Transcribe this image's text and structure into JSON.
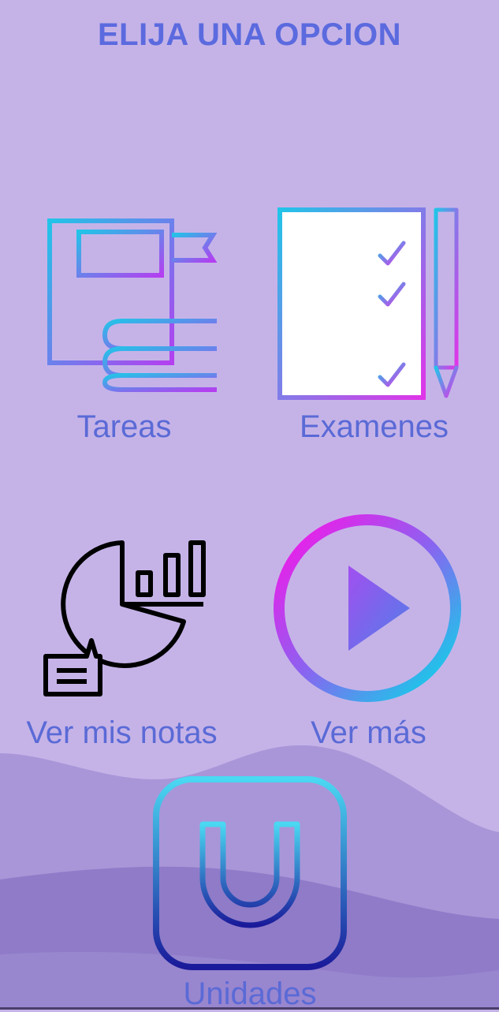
{
  "screen": {
    "title": "ELIJA UNA OPCION",
    "background_color": "#c5b3e8",
    "accent_color": "#5b6ade"
  },
  "options": [
    {
      "label": "Tareas",
      "icon": "books-icon"
    },
    {
      "label": "Examenes",
      "icon": "exam-checklist-icon"
    },
    {
      "label": "Ver mis notas",
      "icon": "grades-chart-icon"
    },
    {
      "label": "Ver más",
      "icon": "play-icon"
    },
    {
      "label": "Unidades",
      "icon": "units-u-icon"
    }
  ]
}
